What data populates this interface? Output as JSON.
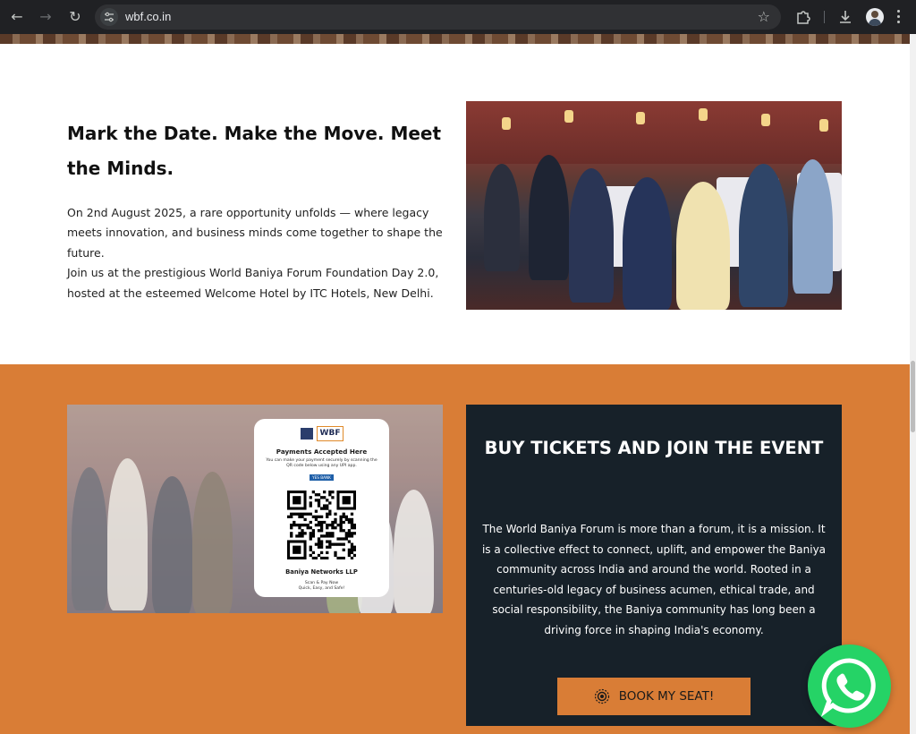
{
  "browser": {
    "url": "wbf.co.in",
    "icons": {
      "back": "arrow-left-icon",
      "forward": "arrow-right-icon",
      "reload": "reload-icon",
      "bookmark": "star-icon",
      "extensions": "puzzle-icon",
      "downloads": "download-icon",
      "menu": "kebab-menu-icon"
    }
  },
  "intro": {
    "title": "Mark the Date. Make the Move. Meet the Minds.",
    "paragraph1": "On 2nd August 2025, a rare opportunity unfolds — where legacy meets innovation, and business minds come together to shape the future.",
    "paragraph2": "Join us at the prestigious World Baniya Forum Foundation Day 2.0, hosted at the esteemed Welcome Hotel by ITC Hotels, New Delhi."
  },
  "payment_card": {
    "logo_text": "WBF",
    "heading": "Payments Accepted Here",
    "subtext": "You can make your payment securely by scanning the QR code below using any UPI app.",
    "bank": "YES BANK",
    "payee": "Baniya Networks LLP",
    "scan_line1": "Scan & Pay Now",
    "scan_line2": "Quick, Easy, and Safe!"
  },
  "tickets": {
    "title": "BUY TICKETS AND JOIN THE EVENT",
    "description": "The World Baniya Forum is more than a forum, it is a mission. It is a collective effect to connect, uplift, and empower the Baniya community across India and around the world. Rooted in a centuries-old legacy of business acumen, ethical trade, and social responsibility, the Baniya community has long been a driving force in shaping India's economy.",
    "button_label": "BOOK MY SEAT!"
  },
  "colors": {
    "accent_orange": "#d97d36",
    "panel_dark": "#172129",
    "whatsapp_green": "#25d366"
  }
}
